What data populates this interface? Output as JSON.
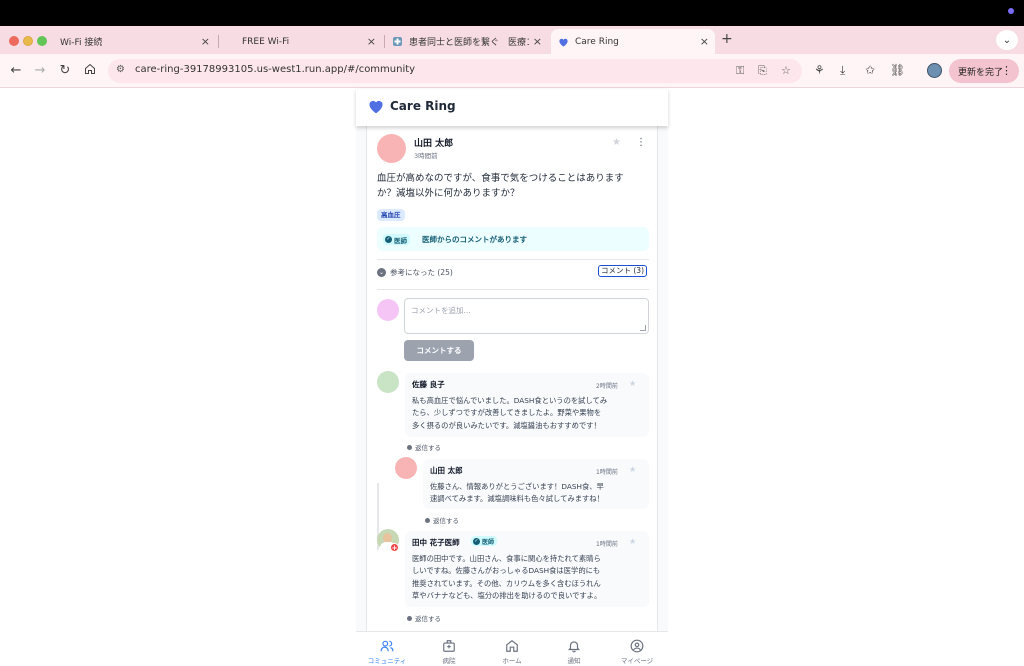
{
  "browser": {
    "tabs": [
      {
        "title": "Wi-Fi 接続",
        "active": false
      },
      {
        "title": "FREE Wi-Fi",
        "active": false
      },
      {
        "title": "患者同士と医師を繋ぐ　医療コミ",
        "active": false
      },
      {
        "title": "Care Ring",
        "active": true
      }
    ],
    "new_tab_glyph": "+",
    "tab_close_glyph": "×",
    "url": "care-ring-39178993105.us-west1.run.app/#/community",
    "update_label": "更新を完了"
  },
  "app": {
    "title": "Care Ring",
    "brand_color": "#4f6fe3"
  },
  "post": {
    "author": "山田 太郎",
    "time": "3時間前",
    "body": "血圧が高めなのですが、食事で気をつけることはありますか？減塩以外に何かありますか？",
    "tag": "高血圧",
    "doctor_badge": "医師",
    "doctor_note": "医師からのコメントがあります",
    "helpful_label": "参考になった (25)",
    "comments_label": "コメント (3)",
    "comment_placeholder": "コメントを追加...",
    "submit_label": "コメントする"
  },
  "comments": [
    {
      "author": "佐藤 良子",
      "time": "2時間前",
      "lines": [
        "私も高血圧で悩んでいました。DASH食というのを試してみ",
        "たら、少しずつですが改善してきましたよ。野菜や果物を",
        "多く摂るのが良いみたいです。減塩醤油もおすすめです！"
      ],
      "reply_label": "返信する"
    },
    {
      "author": "山田 太郎",
      "time": "1時間前",
      "lines": [
        "佐藤さん、情報ありがとうございます！DASH食、早",
        "速調べてみます。減塩調味料も色々試してみますね！"
      ],
      "reply_label": "返信する"
    },
    {
      "author": "田中 花子医師",
      "badge": "医師",
      "time": "1時間前",
      "lines": [
        "医師の田中です。山田さん、食事に関心を持たれて素晴ら",
        "しいですね。佐藤さんがおっしゃるDASH食は医学的にも",
        "推奨されています。その他、カリウムを多く含むほうれん",
        "草やバナナなども、塩分の排出を助けるので良いですよ。"
      ],
      "reply_label": "返信する"
    }
  ],
  "bottom_nav": [
    {
      "label": "コミュニティ",
      "icon": "users-icon",
      "active": true
    },
    {
      "label": "病院",
      "icon": "hospital-icon",
      "active": false
    },
    {
      "label": "ホーム",
      "icon": "home-icon",
      "active": false
    },
    {
      "label": "通知",
      "icon": "bell-icon",
      "active": false
    },
    {
      "label": "マイページ",
      "icon": "user-circle-icon",
      "active": false
    }
  ],
  "colors": {
    "accent": "#3b82f6",
    "doctor": "#155e75",
    "avatar_post": "#f8b4b4",
    "avatar_me": "#f5c6f5",
    "avatar_sato": "#c9e4c5"
  }
}
